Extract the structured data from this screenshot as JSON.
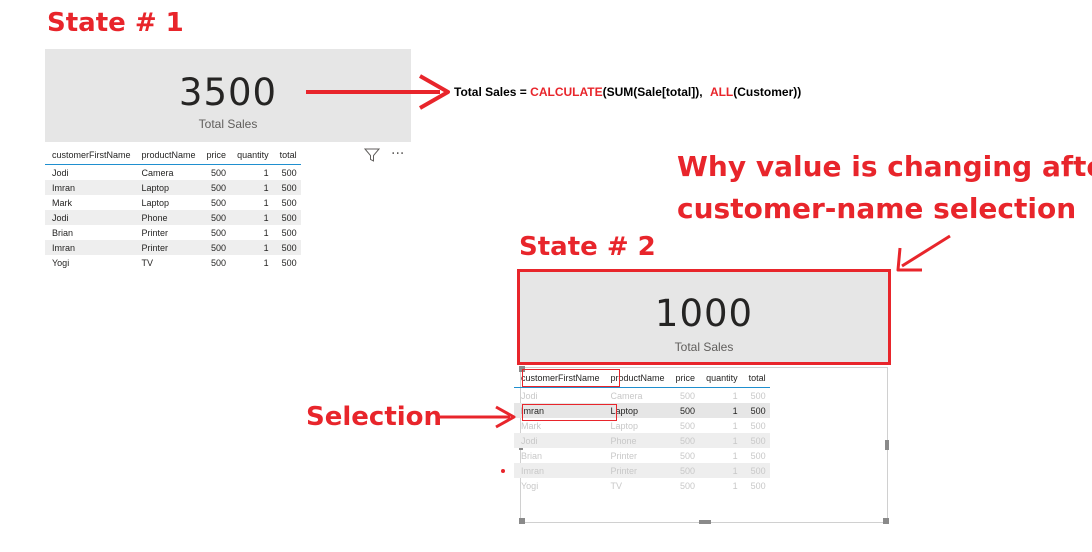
{
  "state1": {
    "heading": "State # 1",
    "card_value": "3500",
    "card_label": "Total Sales",
    "columns": [
      "customerFirstName",
      "productName",
      "price",
      "quantity",
      "total"
    ],
    "rows": [
      [
        "Jodi",
        "Camera",
        "500",
        "1",
        "500"
      ],
      [
        "Imran",
        "Laptop",
        "500",
        "1",
        "500"
      ],
      [
        "Mark",
        "Laptop",
        "500",
        "1",
        "500"
      ],
      [
        "Jodi",
        "Phone",
        "500",
        "1",
        "500"
      ],
      [
        "Brian",
        "Printer",
        "500",
        "1",
        "500"
      ],
      [
        "Imran",
        "Printer",
        "500",
        "1",
        "500"
      ],
      [
        "Yogi",
        "TV",
        "500",
        "1",
        "500"
      ]
    ],
    "more_options": "···"
  },
  "formula": {
    "prefix": "Total Sales = ",
    "fn1": "CALCULATE",
    "part2": "(SUM(Sale[total]), ",
    "fn2": "ALL",
    "part3": "(Customer))"
  },
  "question": {
    "line1": "Why value is changing after",
    "line2": "customer-name selection"
  },
  "state2": {
    "heading": "State # 2",
    "card_value": "1000",
    "card_label": "Total Sales",
    "columns": [
      "customerFirstName",
      "productName",
      "price",
      "quantity",
      "total"
    ],
    "rows": [
      [
        "Jodi",
        "Camera",
        "500",
        "1",
        "500"
      ],
      [
        "Imran",
        "Laptop",
        "500",
        "1",
        "500"
      ],
      [
        "Mark",
        "Laptop",
        "500",
        "1",
        "500"
      ],
      [
        "Jodi",
        "Phone",
        "500",
        "1",
        "500"
      ],
      [
        "Brian",
        "Printer",
        "500",
        "1",
        "500"
      ],
      [
        "Imran",
        "Printer",
        "500",
        "1",
        "500"
      ],
      [
        "Yogi",
        "TV",
        "500",
        "1",
        "500"
      ]
    ],
    "selected_row": 1
  },
  "selection_label": "Selection",
  "colors": {
    "annotation_red": "#e8252b",
    "card_bg": "#e6e6e6",
    "header_rule": "#1f8fcf"
  }
}
